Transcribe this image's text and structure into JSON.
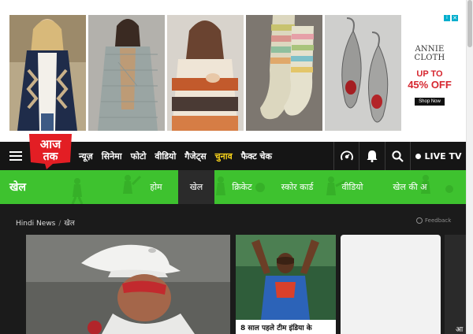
{
  "ad": {
    "brand": "ANNIE CLOTH",
    "upto": "UP TO",
    "offer": "45% OFF",
    "cta": "Shop Now",
    "info_glyph": "i",
    "close_glyph": "✕"
  },
  "logo": {
    "top_text": "आज",
    "bottom_text": "तक"
  },
  "nav": {
    "items": [
      {
        "label": "न्यूज़",
        "highlight": false
      },
      {
        "label": "सिनेमा",
        "highlight": false
      },
      {
        "label": "फोटो",
        "highlight": false
      },
      {
        "label": "वीडियो",
        "highlight": false
      },
      {
        "label": "गैजेट्स",
        "highlight": false
      },
      {
        "label": "चुनाव",
        "highlight": true
      },
      {
        "label": "फैक्ट चेक",
        "highlight": false
      }
    ],
    "icons": [
      "podcast-icon",
      "bell-icon",
      "search-icon"
    ],
    "live_label": "LIVE TV"
  },
  "section": {
    "title": "खेल",
    "tabs": [
      {
        "label": "होम",
        "active": false
      },
      {
        "label": "खेल",
        "active": true
      },
      {
        "label": "क्रिकेट",
        "active": false
      },
      {
        "label": "स्कोर कार्ड",
        "active": false
      },
      {
        "label": "वीडियो",
        "active": false
      },
      {
        "label": "खेल की अ",
        "active": false
      }
    ]
  },
  "breadcrumb": {
    "home": "Hindi News",
    "separator": "/",
    "current": "खेल"
  },
  "feedback": "Feedback",
  "cards": {
    "second_title": "8 साल पहले टीम इंडिया के",
    "fourth_text": "आ"
  },
  "colors": {
    "navbar": "#151515",
    "section_green": "#3ec22f",
    "highlight_yellow": "#f7d21b",
    "logo_red": "#e31e24",
    "offer_red": "#d6262f"
  }
}
